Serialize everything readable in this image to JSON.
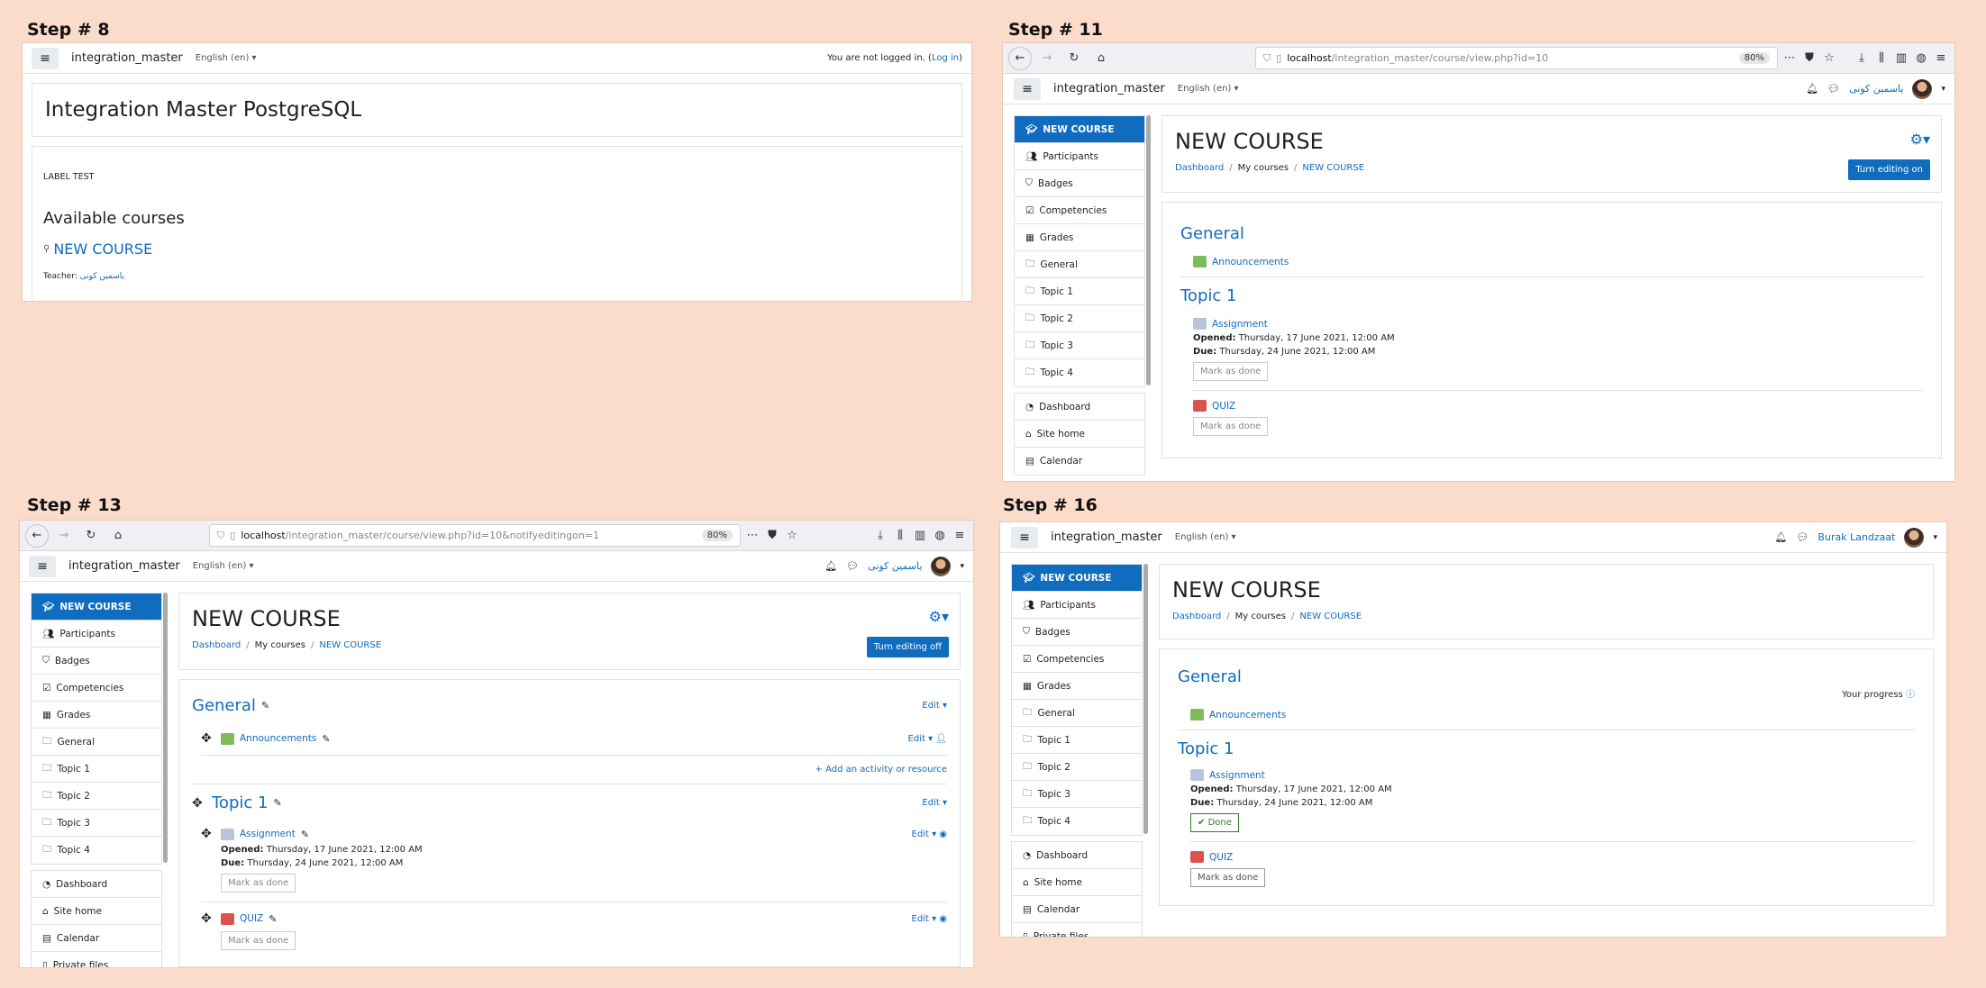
{
  "steps": [
    "Step # 8",
    "Step # 11",
    "Step # 13",
    "Step # 16"
  ],
  "common": {
    "site": "integration_master",
    "lang": "English (en)",
    "user_ar": "یاسمین کونی",
    "user_en": "Burak Landzaat",
    "course": "NEW COURSE",
    "dashboard": "Dashboard",
    "mycourses": "My courses",
    "general": "General",
    "topic1": "Topic 1",
    "announcements": "Announcements",
    "assignment": "Assignment",
    "quiz": "QUIZ",
    "opened_l": "Opened:",
    "opened_v": "Thursday, 17 June 2021, 12:00 AM",
    "due_l": "Due:",
    "due_v": "Thursday, 24 June 2021, 12:00 AM",
    "mark": "Mark as done",
    "done": "Done",
    "edit": "Edit",
    "edit_on": "Turn editing on",
    "edit_off": "Turn editing off",
    "add": "Add an activity or resource",
    "progress": "Your progress"
  },
  "nav": [
    "Participants",
    "Badges",
    "Competencies",
    "Grades",
    "General",
    "Topic 1",
    "Topic 2",
    "Topic 3",
    "Topic 4"
  ],
  "nav2": [
    "Dashboard",
    "Site home",
    "Calendar",
    "Private files"
  ],
  "s8": {
    "notlogged": "You are not logged in. (",
    "login": "Log in",
    "close": ")",
    "title": "Integration Master PostgreSQL",
    "label": "LABEL TEST",
    "avail": "Available courses",
    "teacher": "Teacher:"
  },
  "urls": {
    "s11_host": "localhost",
    "s11_path": "/integration_master/course/view.php?id=10",
    "s13_path": "/integration_master/course/view.php?id=10&notifyeditingon=1",
    "zoom": "80%"
  }
}
